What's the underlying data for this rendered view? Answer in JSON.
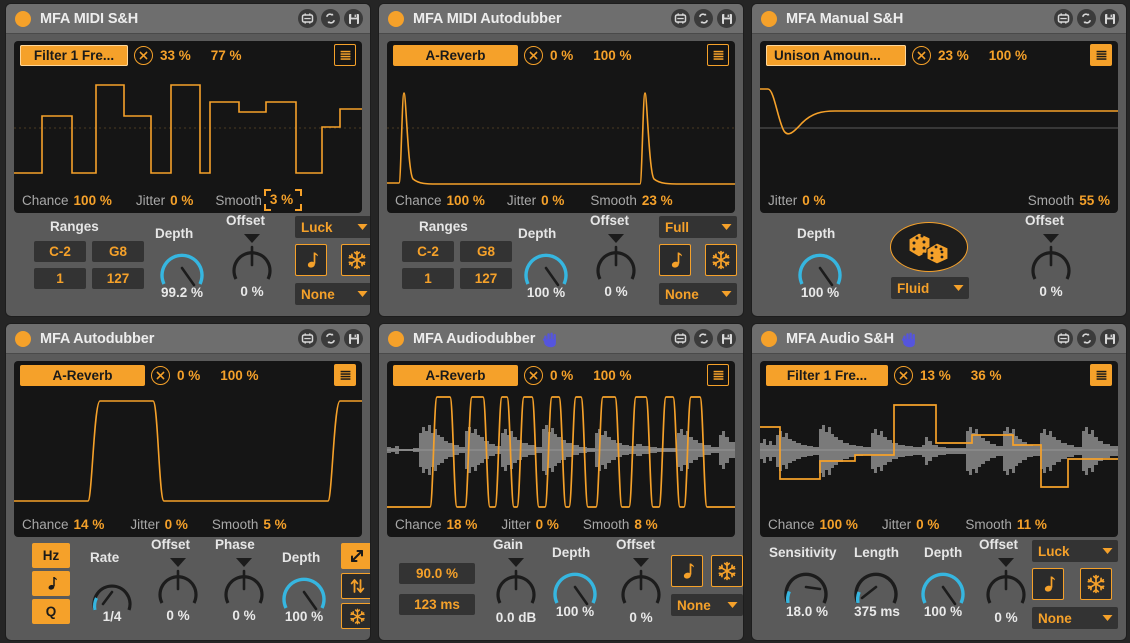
{
  "theme": {
    "accent": "#f5a12a",
    "knob_arc": "#36b6e0",
    "panel_bg": "#5a5a5a",
    "header_bg": "#6e6e6e",
    "scope_bg": "#151515",
    "text_light": "#e6e6e6",
    "text_dim": "#a8a8a8",
    "hand_blue": "#5555dd"
  },
  "head_icons": [
    {
      "name": "max-patcher-icon",
      "label": "Max patcher"
    },
    {
      "name": "reload-icon",
      "label": "Reload"
    },
    {
      "name": "save-icon",
      "label": "Save"
    }
  ],
  "devices": [
    {
      "id": "mfa-midi-sh",
      "title": "MFA MIDI S&H",
      "hand": false,
      "scope": {
        "map_target": "Filter 1 Fre...",
        "map_outlined": true,
        "min_pct": "33 %",
        "max_pct": "77 %",
        "list_filled": false,
        "footer": [
          {
            "label": "Chance",
            "value": "100 %",
            "selected": false
          },
          {
            "label": "Jitter",
            "value": "0 %",
            "selected": false
          },
          {
            "label": "Smooth",
            "value": "3 %",
            "selected": true
          }
        ]
      },
      "controls": {
        "ranges_label": "Ranges",
        "ranges": [
          "C-2",
          "G8",
          "1",
          "127"
        ],
        "depth_label": "Depth",
        "depth_value": "99.2 %",
        "offset_label": "Offset",
        "offset_value": "0 %",
        "mode_dropdown": "Luck",
        "sync_dropdown": "None",
        "note_toggle": "note-icon",
        "freeze_toggle": "snowflake-icon"
      }
    },
    {
      "id": "mfa-midi-autodubber",
      "title": "MFA MIDI Autodubber",
      "hand": false,
      "scope": {
        "map_target": "A-Reverb",
        "map_outlined": false,
        "min_pct": "0 %",
        "max_pct": "100 %",
        "list_filled": false,
        "footer": [
          {
            "label": "Chance",
            "value": "100 %",
            "selected": false
          },
          {
            "label": "Jitter",
            "value": "0 %",
            "selected": false
          },
          {
            "label": "Smooth",
            "value": "23 %",
            "selected": false
          }
        ]
      },
      "controls": {
        "ranges_label": "Ranges",
        "ranges": [
          "C-2",
          "G8",
          "1",
          "127"
        ],
        "depth_label": "Depth",
        "depth_value": "100 %",
        "offset_label": "Offset",
        "offset_value": "0 %",
        "mode_dropdown": "Full",
        "sync_dropdown": "None",
        "note_toggle": "note-icon",
        "freeze_toggle": "snowflake-icon"
      }
    },
    {
      "id": "mfa-manual-sh",
      "title": "MFA Manual S&H",
      "hand": false,
      "scope": {
        "map_target": "Unison Amoun...",
        "map_outlined": true,
        "min_pct": "23 %",
        "max_pct": "100 %",
        "list_filled": true,
        "footer": [
          {
            "label": "Jitter",
            "value": "0 %",
            "selected": false
          },
          {
            "label": "Smooth",
            "value": "55 %",
            "selected": false
          }
        ]
      },
      "controls": {
        "depth_label": "Depth",
        "depth_value": "100 %",
        "offset_label": "Offset",
        "offset_value": "0 %",
        "dice_button": "dice-icon",
        "mode_dropdown": "Fluid"
      }
    },
    {
      "id": "mfa-autodubber",
      "title": "MFA Autodubber",
      "hand": false,
      "scope": {
        "map_target": "A-Reverb",
        "map_outlined": false,
        "min_pct": "0 %",
        "max_pct": "100 %",
        "list_filled": true,
        "footer": [
          {
            "label": "Chance",
            "value": "14 %",
            "selected": false
          },
          {
            "label": "Jitter",
            "value": "0 %",
            "selected": false
          },
          {
            "label": "Smooth",
            "value": "5 %",
            "selected": false
          }
        ]
      },
      "controls": {
        "unit_buttons": [
          {
            "label": "Hz",
            "name": "hz-button",
            "active": true,
            "outlined": true
          },
          {
            "label": "note-icon",
            "name": "note-button",
            "active": true,
            "outlined": false
          },
          {
            "label": "Q",
            "name": "q-button",
            "active": true,
            "outlined": false
          }
        ],
        "rate_label": "Rate",
        "rate_value": "1/4",
        "offset_label": "Offset",
        "offset_value": "0 %",
        "phase_label": "Phase",
        "phase_value": "0 %",
        "depth_label": "Depth",
        "depth_value": "100 %",
        "side_toggles": [
          {
            "name": "expand-arrow-icon",
            "active": true
          },
          {
            "name": "updown-arrow-icon",
            "active": false
          },
          {
            "name": "snowflake-icon",
            "active": false
          }
        ]
      }
    },
    {
      "id": "mfa-audiodubber",
      "title": "MFA Audiodubber",
      "hand": true,
      "scope": {
        "map_target": "A-Reverb",
        "map_outlined": false,
        "min_pct": "0 %",
        "max_pct": "100 %",
        "list_filled": false,
        "footer": [
          {
            "label": "Chance",
            "value": "18 %",
            "selected": false
          },
          {
            "label": "Jitter",
            "value": "0 %",
            "selected": false
          },
          {
            "label": "Smooth",
            "value": "8 %",
            "selected": false
          }
        ]
      },
      "controls": {
        "threshold_value": "90.0 %",
        "time_value": "123 ms",
        "gain_label": "Gain",
        "gain_value": "0.0 dB",
        "depth_label": "Depth",
        "depth_value": "100 %",
        "offset_label": "Offset",
        "offset_value": "0 %",
        "note_toggle": "note-icon",
        "freeze_toggle": "snowflake-icon",
        "sync_dropdown": "None"
      }
    },
    {
      "id": "mfa-audio-sh",
      "title": "MFA Audio S&H",
      "hand": true,
      "scope": {
        "map_target": "Filter 1 Fre...",
        "map_outlined": false,
        "min_pct": "13 %",
        "max_pct": "36 %",
        "list_filled": true,
        "footer": [
          {
            "label": "Chance",
            "value": "100 %",
            "selected": false
          },
          {
            "label": "Jitter",
            "value": "0 %",
            "selected": false
          },
          {
            "label": "Smooth",
            "value": "11 %",
            "selected": false
          }
        ]
      },
      "controls": {
        "sensitivity_label": "Sensitivity",
        "sensitivity_value": "18.0 %",
        "length_label": "Length",
        "length_value": "375 ms",
        "depth_label": "Depth",
        "depth_value": "100 %",
        "offset_label": "Offset",
        "offset_value": "0 %",
        "mode_dropdown": "Luck",
        "sync_dropdown": "None",
        "note_toggle": "note-icon",
        "freeze_toggle": "snowflake-icon"
      }
    }
  ]
}
